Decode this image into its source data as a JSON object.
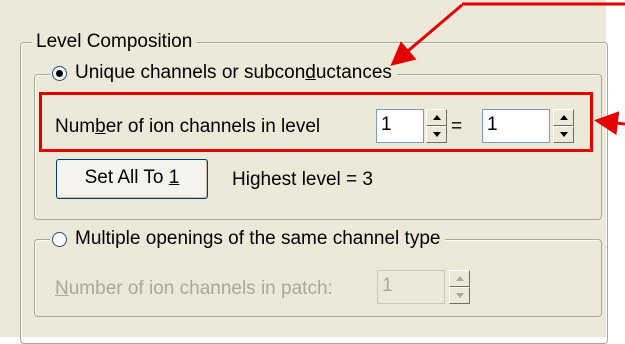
{
  "level_composition": {
    "title": "Level Composition",
    "unique": {
      "label_before": "Unique channels or subcon",
      "label_underline": "d",
      "label_after": "uctances",
      "checked": true,
      "channels_label_before": "Num",
      "channels_label_underline": "b",
      "channels_label_after": "er of ion channels in level",
      "value_from": "1",
      "equals": "=",
      "value_to": "1",
      "set_all_before": "Set All To ",
      "set_all_underline": "1",
      "highest_level": "Highest level = 3"
    },
    "multiple": {
      "label_before": "Multiple openin",
      "label_underline": "g",
      "label_after": "s of the same channel type",
      "checked": false,
      "patch_label_underline": "N",
      "patch_label_after": "umber of ion channels in patch:",
      "patch_value": "1"
    }
  },
  "annotation": {
    "color": "#e40000"
  }
}
